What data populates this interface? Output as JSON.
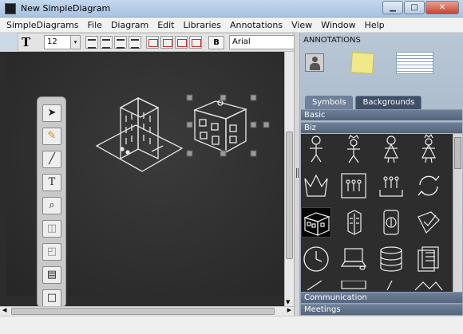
{
  "window": {
    "title": "New SimpleDiagram"
  },
  "window_controls": {
    "minimize": "▁",
    "maximize": "□",
    "close": "✕"
  },
  "menu": [
    "SimpleDiagrams",
    "File",
    "Diagram",
    "Edit",
    "Libraries",
    "Annotations",
    "View",
    "Window",
    "Help"
  ],
  "toolbar": {
    "text_icon": "T",
    "font_size": "12",
    "dropdown_glyph": "▾",
    "bold_label": "B",
    "font_family": "Arial"
  },
  "canvas": {
    "background": "#2b2b2b"
  },
  "tools": [
    {
      "name": "select-tool",
      "icon": "arrow-pointer-icon",
      "glyph": "➤"
    },
    {
      "name": "pencil-tool",
      "icon": "pencil-icon",
      "glyph": "✎"
    },
    {
      "name": "line-tool",
      "icon": "line-icon",
      "glyph": "╱"
    },
    {
      "name": "text-tool",
      "icon": "text-icon",
      "glyph": "T"
    },
    {
      "name": "zoom-tool",
      "icon": "magnifier-icon",
      "glyph": "⌕"
    },
    {
      "name": "bring-forward-tool",
      "icon": "layers-icon",
      "glyph": "◫"
    },
    {
      "name": "send-backward-tool",
      "icon": "layers-back-icon",
      "glyph": "◰"
    },
    {
      "name": "align-tool",
      "icon": "align-icon",
      "glyph": "▤"
    },
    {
      "name": "color-tool",
      "icon": "color-swatch-icon",
      "glyph": "□"
    }
  ],
  "right_panel": {
    "annotations_label": "ANNOTATIONS",
    "tabs": [
      {
        "label": "Symbols",
        "active": false
      },
      {
        "label": "Backgrounds",
        "active": true
      }
    ],
    "sections": [
      "Basic",
      "Biz",
      "Communication",
      "Meetings"
    ]
  }
}
